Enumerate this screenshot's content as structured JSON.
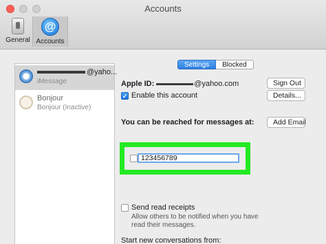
{
  "window": {
    "title": "Accounts"
  },
  "toolbar": {
    "general_label": "General",
    "accounts_label": "Accounts",
    "general_icon": "switch-icon",
    "accounts_icon": "at-sign-icon"
  },
  "sidebar": {
    "accounts": [
      {
        "name": "@yaho...",
        "subtitle": "iMessage",
        "icon": "imessage-icon",
        "selected": true
      },
      {
        "name": "Bonjour",
        "subtitle": "Bonjour (Inactive)",
        "icon": "bonjour-icon",
        "selected": false
      }
    ]
  },
  "tabs": {
    "settings_label": "Settings",
    "blocked_label": "Blocked",
    "active": "Settings"
  },
  "account": {
    "apple_id_label": "Apple ID:",
    "apple_id_value": "@yahoo.com",
    "sign_out_label": "Sign Out",
    "enable_label": "Enable this account",
    "enable_checked": true,
    "details_label": "Details..."
  },
  "reach": {
    "heading": "You can be reached for messages at:",
    "add_email_label": "Add Email",
    "phone_value": "123456789",
    "phone_checked": false,
    "highlight_color": "#23ea23"
  },
  "receipts": {
    "label": "Send read receipts",
    "checked": false,
    "description": "Allow others to be notified when you have read their messages."
  },
  "start_conversations": {
    "label": "Start new conversations from:"
  },
  "colors": {
    "accent": "#2f7fe0",
    "close": "#fc5f57"
  }
}
